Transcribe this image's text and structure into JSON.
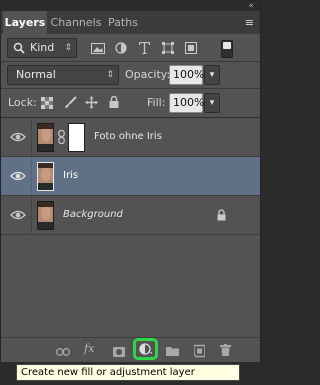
{
  "tabs": [
    {
      "label": "Layers",
      "active": true
    },
    {
      "label": "Channels",
      "active": false
    },
    {
      "label": "Paths",
      "active": false
    }
  ],
  "icons": {
    "collapse": "«",
    "menu": "≡",
    "kind_dropdown": "⇕",
    "blend_dropdown": "⇕",
    "fill_dropdown": "▾"
  },
  "filter": {
    "label": "Kind"
  },
  "blend_mode": "Normal",
  "opacity": {
    "label": "Opacity:",
    "value": "100%"
  },
  "lock_label": "Lock:",
  "fill": {
    "label": "Fill:",
    "value": "100%"
  },
  "layers": [
    {
      "name": "Foto ohne Iris",
      "selected": false,
      "has_mask": true,
      "locked": false
    },
    {
      "name": "Iris",
      "selected": true,
      "has_mask": false,
      "locked": false
    },
    {
      "name": "Background",
      "selected": false,
      "has_mask": false,
      "locked": true
    }
  ],
  "bottom": {
    "fx": "fx"
  },
  "tooltip": "Create new fill or adjustment layer",
  "colors": {
    "panel": "#535353",
    "selected": "#5f7087",
    "highlight": "#2fd64a",
    "tooltip_bg": "#ffffe1"
  }
}
